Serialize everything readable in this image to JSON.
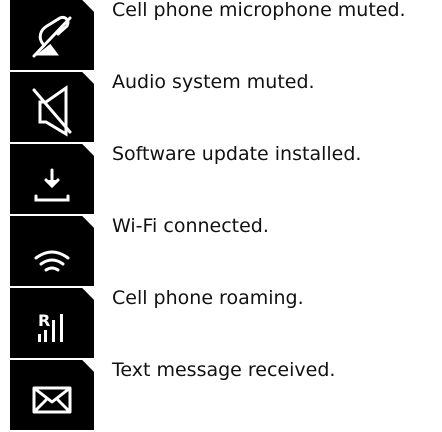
{
  "items": [
    {
      "icon": "microphone-muted-icon",
      "label": "Cell phone microphone muted."
    },
    {
      "icon": "speaker-muted-icon",
      "label": "Audio system muted."
    },
    {
      "icon": "download-icon",
      "label": "Software update installed."
    },
    {
      "icon": "wifi-icon",
      "label": "Wi-Fi connected."
    },
    {
      "icon": "roaming-signal-icon",
      "label": "Cell phone roaming."
    },
    {
      "icon": "envelope-icon",
      "label": "Text message received."
    }
  ],
  "colors": {
    "icon_background": "#000000",
    "icon_foreground": "#ffffff",
    "text": "#111111"
  }
}
